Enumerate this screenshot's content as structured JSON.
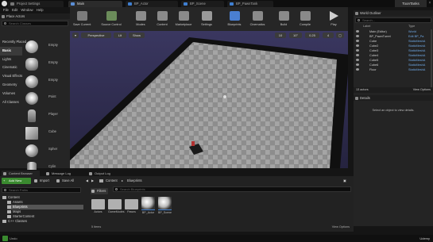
{
  "titlebar": {
    "tabs": [
      {
        "label": "Project Settings",
        "active": false
      },
      {
        "label": "Main",
        "active": true
      },
      {
        "label": "BP_Actor",
        "active": false
      },
      {
        "label": "BP_Scene",
        "active": false
      },
      {
        "label": "BP_PawnTank",
        "active": false
      }
    ],
    "project_name": "ToonTanks"
  },
  "menu": [
    "File",
    "Edit",
    "Window",
    "Help"
  ],
  "place_actors": {
    "title": "Place Actors",
    "search_placeholder": "Search Classes",
    "categories": [
      "Recently Placed",
      "Basic",
      "Lights",
      "Cinematic",
      "Visual Effects",
      "Geometry",
      "Volumes",
      "All Classes"
    ],
    "selected_category": "Basic",
    "items": [
      {
        "label": "Empty",
        "icon": "empty-actor-icon"
      },
      {
        "label": "Empty",
        "icon": "empty-character-icon"
      },
      {
        "label": "Empty",
        "icon": "empty-pawn-icon"
      },
      {
        "label": "Point",
        "icon": "point-light-icon"
      },
      {
        "label": "Player",
        "icon": "player-start-icon"
      },
      {
        "label": "Cube",
        "icon": "cube-icon"
      },
      {
        "label": "Spher",
        "icon": "sphere-icon"
      },
      {
        "label": "Cylin",
        "icon": "cylinder-icon"
      },
      {
        "label": "Cone",
        "icon": "cone-icon"
      },
      {
        "label": "Plane",
        "icon": "plane-icon"
      },
      {
        "label": "Box T",
        "icon": "box-trigger-icon"
      }
    ]
  },
  "toolbar": {
    "buttons": [
      {
        "label": "Save Current",
        "icon": "save-icon"
      },
      {
        "label": "Source Control",
        "icon": "source-control-icon"
      },
      {
        "label": "Modes",
        "icon": "modes-icon"
      },
      {
        "label": "Content",
        "icon": "content-icon"
      },
      {
        "label": "Marketplace",
        "icon": "marketplace-icon"
      },
      {
        "label": "Settings",
        "icon": "settings-icon"
      },
      {
        "label": "Blueprints",
        "icon": "blueprints-icon"
      },
      {
        "label": "Cinematics",
        "icon": "cinematics-icon"
      },
      {
        "label": "Build",
        "icon": "build-icon"
      },
      {
        "label": "Compile",
        "icon": "compile-icon"
      },
      {
        "label": "Play",
        "icon": "play-icon"
      }
    ]
  },
  "viewport": {
    "perspective": "Perspective",
    "lit": "Lit",
    "show": "Show",
    "grid_snap": "10",
    "rot_snap": "10°",
    "scale_snap": "0.25",
    "camera_speed": "4"
  },
  "world_outliner": {
    "title": "World Outliner",
    "search_placeholder": "Search...",
    "col_label": "Label",
    "col_type": "Type",
    "rows": [
      {
        "name": "Main (Editor)",
        "type": "World"
      },
      {
        "name": "BP_PawnTurret",
        "type": "Edit BP_Pa"
      },
      {
        "name": "Cube",
        "type": "StaticMeshA"
      },
      {
        "name": "Cube2",
        "type": "StaticMeshA"
      },
      {
        "name": "Cube3",
        "type": "StaticMeshA"
      },
      {
        "name": "Cube4",
        "type": "StaticMeshA"
      },
      {
        "name": "Cube5",
        "type": "StaticMeshA"
      },
      {
        "name": "Cube6",
        "type": "StaticMeshA"
      },
      {
        "name": "Floor",
        "type": "StaticMeshA"
      }
    ],
    "actor_count": "13 actors",
    "view_options": "View Options"
  },
  "details": {
    "title": "Details",
    "empty_text": "Select an object to view details."
  },
  "bottom_tabs": [
    {
      "label": "Content Browser",
      "icon": "content-browser-icon"
    },
    {
      "label": "Message Log",
      "icon": "message-log-icon"
    },
    {
      "label": "Output Log",
      "icon": "output-log-icon"
    }
  ],
  "content_browser": {
    "add_new": "Add New",
    "import": "Import",
    "save_all": "Save All",
    "path": [
      "Content",
      "Blueprints"
    ],
    "search_paths_placeholder": "Search Paths",
    "search_assets_placeholder": "Search Blueprints",
    "filters": "Filters",
    "tree": [
      {
        "label": "Content",
        "level": 0,
        "selected": false
      },
      {
        "label": "Assets",
        "level": 1,
        "selected": false
      },
      {
        "label": "Blueprints",
        "level": 1,
        "selected": true
      },
      {
        "label": "Maps",
        "level": 1,
        "selected": false
      },
      {
        "label": "StarterContent",
        "level": 1,
        "selected": false
      },
      {
        "label": "C++ Classes",
        "level": 0,
        "selected": false
      }
    ],
    "assets": [
      {
        "label": "Actors",
        "kind": "folder"
      },
      {
        "label": "GameModes",
        "kind": "folder"
      },
      {
        "label": "Pawns",
        "kind": "folder"
      },
      {
        "label": "BP_Actor",
        "kind": "blueprint"
      },
      {
        "label": "BP_Scene",
        "kind": "blueprint"
      }
    ],
    "item_count": "5 items",
    "view_options": "View Options"
  },
  "status": {
    "undo": "Undo",
    "user": "Udemy"
  },
  "colors": {
    "sky": "#2f2c4e",
    "floor_light": "#9e9e9e",
    "floor_dark": "#6c6c6c",
    "wall": "#0e0e0e",
    "accent_green": "#3a8a2f",
    "link_blue": "#6fa9e6"
  }
}
